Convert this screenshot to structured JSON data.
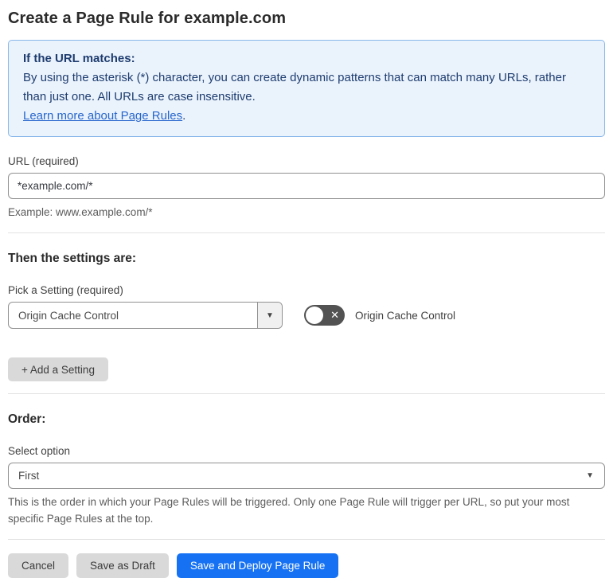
{
  "page": {
    "title": "Create a Page Rule for example.com"
  },
  "info_box": {
    "heading": "If the URL matches:",
    "body": "By using the asterisk (*) character, you can create dynamic patterns that can match many URLs, rather than just one. All URLs are case insensitive.",
    "link_label": "Learn more about Page Rules",
    "link_suffix": "."
  },
  "url_section": {
    "label": "URL (required)",
    "value": "*example.com/*",
    "example": "Example: www.example.com/*"
  },
  "settings_section": {
    "heading": "Then the settings are:",
    "pick_label": "Pick a Setting (required)",
    "selected_setting": "Origin Cache Control",
    "toggle_state": "off",
    "toggle_label": "Origin Cache Control",
    "add_button_label": "+ Add a Setting"
  },
  "order_section": {
    "heading": "Order:",
    "label": "Select option",
    "selected_option": "First",
    "help_text": "This is the order in which your Page Rules will be triggered. Only one Page Rule will trigger per URL, so put your most specific Page Rules at the top."
  },
  "footer": {
    "cancel_label": "Cancel",
    "save_draft_label": "Save as Draft",
    "save_deploy_label": "Save and Deploy Page Rule"
  },
  "icons": {
    "dropdown_arrow": "▼",
    "toggle_off": "✕"
  },
  "colors": {
    "accent_blue": "#1672f3",
    "info_background": "#eaf3fc",
    "info_border": "#88b7e9",
    "info_text": "#1e3c6f",
    "link_blue": "#2765cc",
    "toggle_off_gray": "#525252"
  }
}
